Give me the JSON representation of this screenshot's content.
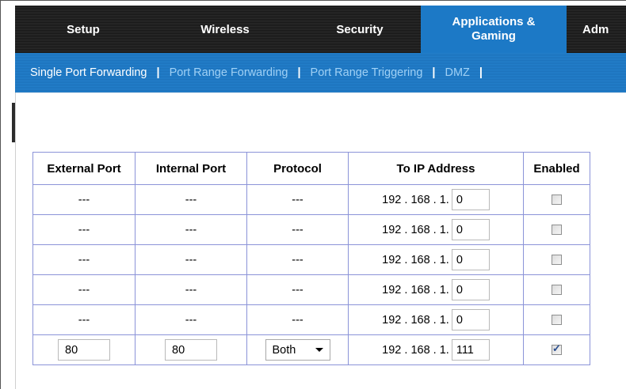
{
  "top_tabs": [
    {
      "label": "Setup"
    },
    {
      "label": "Wireless"
    },
    {
      "label": "Security"
    },
    {
      "label": "Applications &\nGaming"
    },
    {
      "label": "Adm"
    }
  ],
  "sub_tabs": [
    {
      "label": "Single Port Forwarding"
    },
    {
      "label": "Port Range Forwarding"
    },
    {
      "label": "Port Range Triggering"
    },
    {
      "label": "DMZ"
    }
  ],
  "separator": "|",
  "table": {
    "headers": [
      "External Port",
      "Internal Port",
      "Protocol",
      "To IP Address",
      "Enabled"
    ],
    "ip_prefix": "192 . 168 . 1.",
    "rows": [
      {
        "external": "---",
        "internal": "---",
        "protocol": "---",
        "ip_last": "0",
        "enabled": false
      },
      {
        "external": "---",
        "internal": "---",
        "protocol": "---",
        "ip_last": "0",
        "enabled": false
      },
      {
        "external": "---",
        "internal": "---",
        "protocol": "---",
        "ip_last": "0",
        "enabled": false
      },
      {
        "external": "---",
        "internal": "---",
        "protocol": "---",
        "ip_last": "0",
        "enabled": false
      },
      {
        "external": "---",
        "internal": "---",
        "protocol": "---",
        "ip_last": "0",
        "enabled": false
      },
      {
        "external": "80",
        "internal": "80",
        "protocol": "Both",
        "ip_last": "111",
        "enabled": true
      }
    ]
  }
}
